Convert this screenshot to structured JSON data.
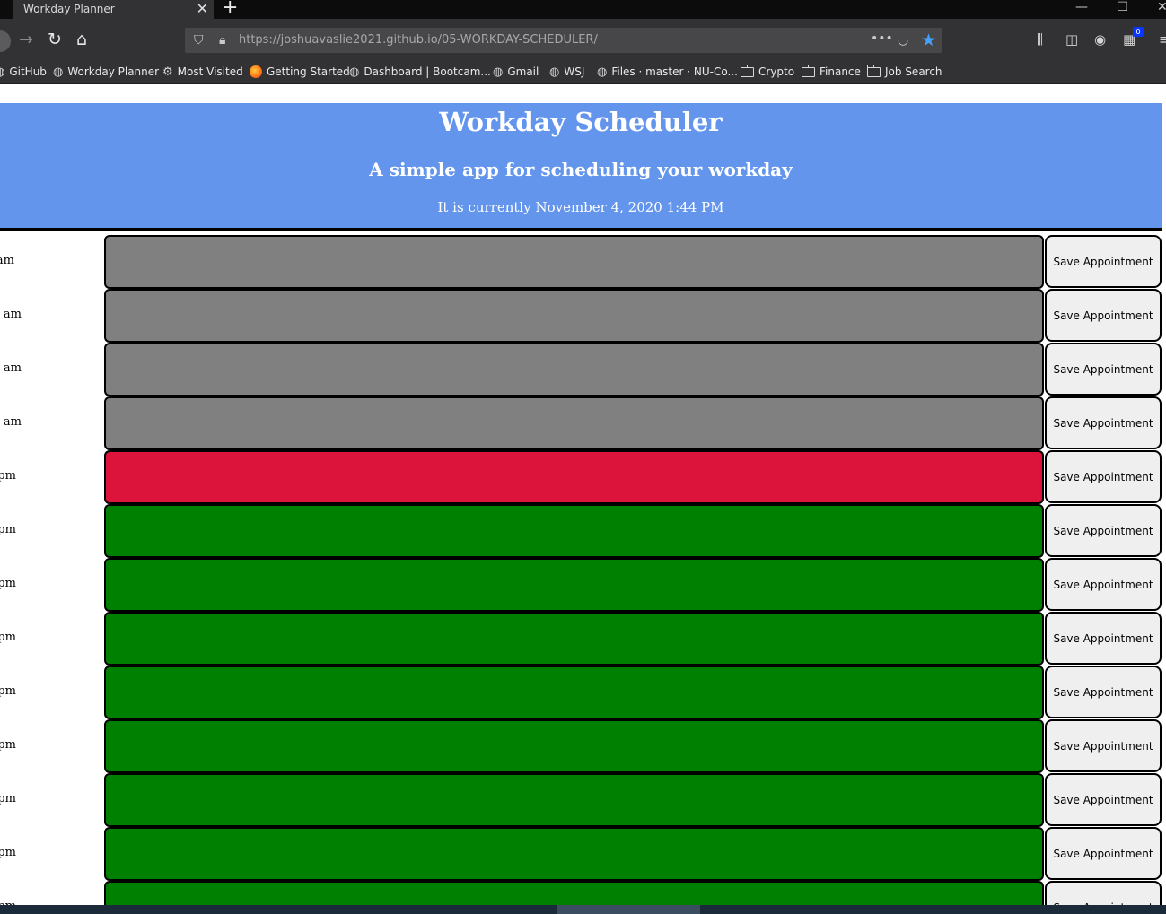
{
  "browser": {
    "tab_title": "Workday Planner",
    "tab_close": "✕",
    "new_tab": "+",
    "url_host": "https://joshuavaslie2021.github.io/",
    "url_path": "05-WORKDAY-SCHEDULER/",
    "toolbar_badge": "0",
    "bookmarks": [
      {
        "label": "GitHub",
        "icon": "globe-icon"
      },
      {
        "label": "Workday Planner",
        "icon": "globe-icon"
      },
      {
        "label": "Most Visited",
        "icon": "gear-icon"
      },
      {
        "label": "Getting Started",
        "icon": "firefox-icon"
      },
      {
        "label": "Dashboard | Bootcam...",
        "icon": "globe-icon"
      },
      {
        "label": "Gmail",
        "icon": "globe-icon"
      },
      {
        "label": "WSJ",
        "icon": "globe-icon"
      },
      {
        "label": "Files · master · NU-Co...",
        "icon": "globe-icon"
      },
      {
        "label": "Crypto",
        "icon": "folder-icon"
      },
      {
        "label": "Finance",
        "icon": "folder-icon"
      },
      {
        "label": "Job Search",
        "icon": "folder-icon"
      }
    ]
  },
  "header": {
    "title": "Workday Scheduler",
    "subtitle": "A simple app for scheduling your workday",
    "current_time": "It is currently November 4, 2020 1:44 PM"
  },
  "colors": {
    "header_bg": "#6495ed",
    "past": "#808080",
    "present": "#dc143c",
    "future": "#008000"
  },
  "schedule": {
    "rows": [
      {
        "hour": "am",
        "status": "past",
        "button": "Save Appointment"
      },
      {
        "hour": "am",
        "status": "past",
        "button": "Save Appointment"
      },
      {
        "hour": "am",
        "status": "past",
        "button": "Save Appointment"
      },
      {
        "hour": "am",
        "status": "past",
        "button": "Save Appointment"
      },
      {
        "hour": "pm",
        "status": "present",
        "button": "Save Appointment"
      },
      {
        "hour": "pm",
        "status": "future",
        "button": "Save Appointment"
      },
      {
        "hour": "pm",
        "status": "future",
        "button": "Save Appointment"
      },
      {
        "hour": "pm",
        "status": "future",
        "button": "Save Appointment"
      },
      {
        "hour": "pm",
        "status": "future",
        "button": "Save Appointment"
      },
      {
        "hour": "pm",
        "status": "future",
        "button": "Save Appointment"
      },
      {
        "hour": "pm",
        "status": "future",
        "button": "Save Appointment"
      },
      {
        "hour": "pm",
        "status": "future",
        "button": "Save Appointment"
      },
      {
        "hour": "pm",
        "status": "future",
        "button": "Save Appointment"
      }
    ]
  }
}
